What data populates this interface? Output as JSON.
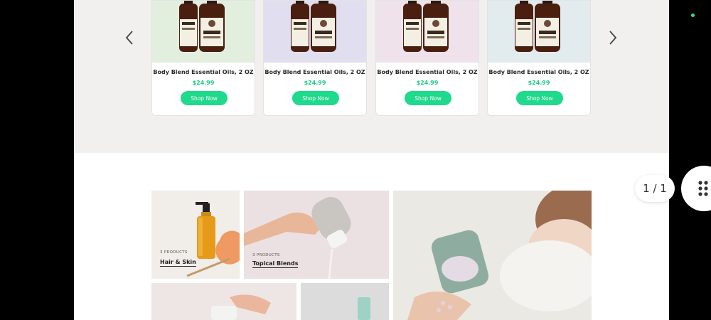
{
  "carousel": {
    "prev_icon": "chevron-left-icon",
    "next_icon": "chevron-right-icon",
    "products": [
      {
        "title": "Body Blend Essential Oils, 2 OZ",
        "price": "$24.99",
        "button": "Shop Now",
        "bg": "#e2efdf"
      },
      {
        "title": "Body Blend Essential Oils, 2 OZ",
        "price": "$24.99",
        "button": "Shop Now",
        "bg": "#e1def0"
      },
      {
        "title": "Body Blend Essential Oils, 2 OZ",
        "price": "$24.99",
        "button": "Shop Now",
        "bg": "#efe2ea"
      },
      {
        "title": "Body Blend Essential Oils, 2 OZ",
        "price": "$24.99",
        "button": "Shop Now",
        "bg": "#e2ebee"
      }
    ]
  },
  "collections": {
    "tiles": [
      {
        "count": "3 PRODUCTS",
        "label": "Hair & Skin"
      },
      {
        "count": "3 PRODUCTS",
        "label": "Topical Blends"
      }
    ]
  },
  "overlay": {
    "pager_text": "1 / 1",
    "menu_icon": "grid-dots-icon"
  },
  "colors": {
    "accent": "#1fd98c",
    "price": "#1ecb86"
  }
}
